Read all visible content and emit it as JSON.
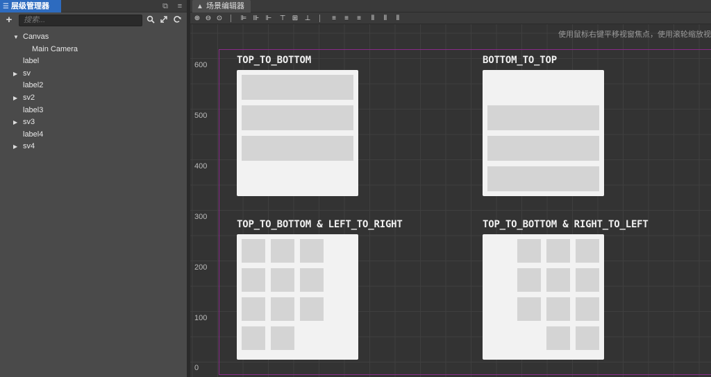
{
  "hierarchy": {
    "tab_label": "层级管理器",
    "search_placeholder": "搜索...",
    "tree": [
      {
        "label": "Canvas",
        "expandable": true,
        "expanded": true,
        "depth": 0
      },
      {
        "label": "Main Camera",
        "expandable": false,
        "depth": 1
      },
      {
        "label": "label",
        "expandable": false,
        "depth": 0
      },
      {
        "label": "sv",
        "expandable": true,
        "expanded": false,
        "depth": 0
      },
      {
        "label": "label2",
        "expandable": false,
        "depth": 0
      },
      {
        "label": "sv2",
        "expandable": true,
        "expanded": false,
        "depth": 0
      },
      {
        "label": "label3",
        "expandable": false,
        "depth": 0
      },
      {
        "label": "sv3",
        "expandable": true,
        "expanded": false,
        "depth": 0
      },
      {
        "label": "label4",
        "expandable": false,
        "depth": 0
      },
      {
        "label": "sv4",
        "expandable": true,
        "expanded": false,
        "depth": 0
      }
    ]
  },
  "scene": {
    "tab_label": "场景编辑器",
    "hint": "使用鼠标右键平移视窗焦点，使用滚轮缩放视",
    "y_axis": [
      "600",
      "500",
      "400",
      "300",
      "200",
      "100",
      "0"
    ],
    "views": [
      {
        "title": "TOP_TO_BOTTOM"
      },
      {
        "title": "BOTTOM_TO_TOP"
      },
      {
        "title": "TOP_TO_BOTTOM & LEFT_TO_RIGHT"
      },
      {
        "title": "TOP_TO_BOTTOM & RIGHT_TO_LEFT"
      }
    ]
  },
  "colors": {
    "tab_active": "#2d6bbf",
    "canvas_frame": "#8b2a8b",
    "scrollview_bg": "#f2f2f2",
    "item_bg": "#d4d4d4"
  }
}
